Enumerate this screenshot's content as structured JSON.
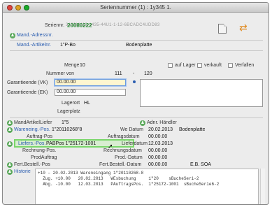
{
  "window": {
    "title": "Seriennummer (1) : 1y345 1."
  },
  "header": {
    "top_code": "3122UU13-1435-44U1-1-12-6BCADC4UDD83",
    "serial_label": "Seriennr.",
    "serial_value": "20080222"
  },
  "article": {
    "address_label": "Mand.-Adressnr.",
    "article_label": "Mand.-Artikelnr.",
    "article_value": "1\"P-Bo",
    "article_name": "Bodenplatte"
  },
  "stock": {
    "menge_label": "Menge",
    "menge_value": "10",
    "auf_lager_label": "auf Lager",
    "verkauft_label": "verkauft",
    "verfallen_label": "Verfallen",
    "nummer_von_label": "Nummer von",
    "nummer_von_value": "111",
    "nummer_bis_sep": "-",
    "nummer_bis_value": "120"
  },
  "guarantee": {
    "vk_label": "Garantieende (VK)",
    "vk_value": "00.00.00",
    "ek_label": "Garantieende (EK)",
    "ek_value": "00.00.00",
    "lagerort_label": "Lagerort",
    "lagerort_value": "HL",
    "lagerplatz_label": "Lagerplatz"
  },
  "supplier": {
    "left_label": "MandArtikelLiefer",
    "left_value": "1\"5",
    "right_label": "Adnr. Händler"
  },
  "documents": {
    "warenging_label": "Wareneing.-Pos.",
    "warenging_value": "1\"20110268\"8",
    "we_datum_label": "We Datum",
    "we_datum_value": "20.02.2013",
    "we_datum_note": "Bodenplatte",
    "auftrag_pos_label": "Auftrag-Pos",
    "auftragsdatum_label": "Auftragsdatum",
    "auftragsdatum_value": "00.00.00",
    "liefer_pos_label": "Liefers.-Pos.",
    "liefer_pos_value": "PABPos 1\"25172-1001",
    "lieferdatum_label": "Lieferdatum",
    "lieferdatum_value": "12.03.2013",
    "rechnung_pos_label": "Rechnung-Pos.",
    "rechnungsdatum_label": "Rechnungsdatum",
    "rechnungsdatum_value": "00.00.00",
    "prod_auftrag_label": "ProdAuftrag",
    "prod_datum_label": "Prod.-Datum",
    "prod_datum_value": "00.00.00",
    "fert_left_label": "Fert.Bestell.-Pos",
    "fert_right_label": "Fert.Bestell.-Datum",
    "fert_right_value": "00.00.00",
    "fert_right_note": "E.B. SOA"
  },
  "history": {
    "label": "Historie",
    "lines": [
      "+10 – 20.02.2013 Wareneingang 1\"20110268-8",
      "  Zug. +10.00   20.02.2013   WEsbuchung     1\"20    sBucheSeri-2",
      "  Abg. -10.00   12.03.2013   PAuftragsPos.  1\"25172-1001  sBucheSerie6-2"
    ]
  },
  "icons": {
    "doc": "document-icon",
    "arrows": "swap-arrows-icon",
    "person": "person-icon"
  }
}
